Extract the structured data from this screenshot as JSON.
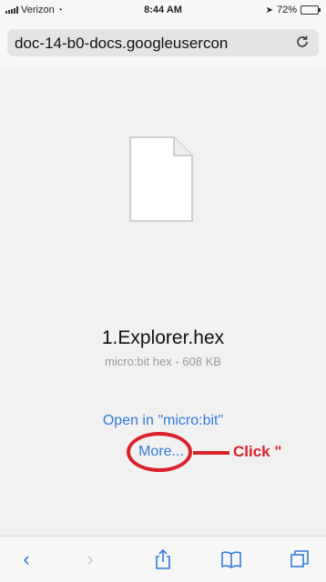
{
  "status_bar": {
    "carrier": "Verizon",
    "time": "8:44 AM",
    "battery_text": "72%",
    "battery_level": 0.72
  },
  "browser": {
    "url": "doc-14-b0-docs.googleusercon",
    "reload_icon": "reload-icon"
  },
  "file": {
    "icon": "document-icon",
    "name": "1.Explorer.hex",
    "meta": "micro:bit hex - 608 KB"
  },
  "actions": {
    "open_in": "Open in \"micro:bit\"",
    "more": "More..."
  },
  "annotation": {
    "text": "Click \"",
    "color": "#d8232a"
  },
  "toolbar": {
    "items": [
      {
        "icon": "back-icon",
        "enabled": true
      },
      {
        "icon": "forward-icon",
        "enabled": false
      },
      {
        "icon": "share-icon",
        "enabled": true
      },
      {
        "icon": "bookmarks-icon",
        "enabled": true
      },
      {
        "icon": "tabs-icon",
        "enabled": true
      }
    ]
  },
  "colors": {
    "link_blue": "#2f7bd8",
    "annotation_red": "#d8232a"
  }
}
